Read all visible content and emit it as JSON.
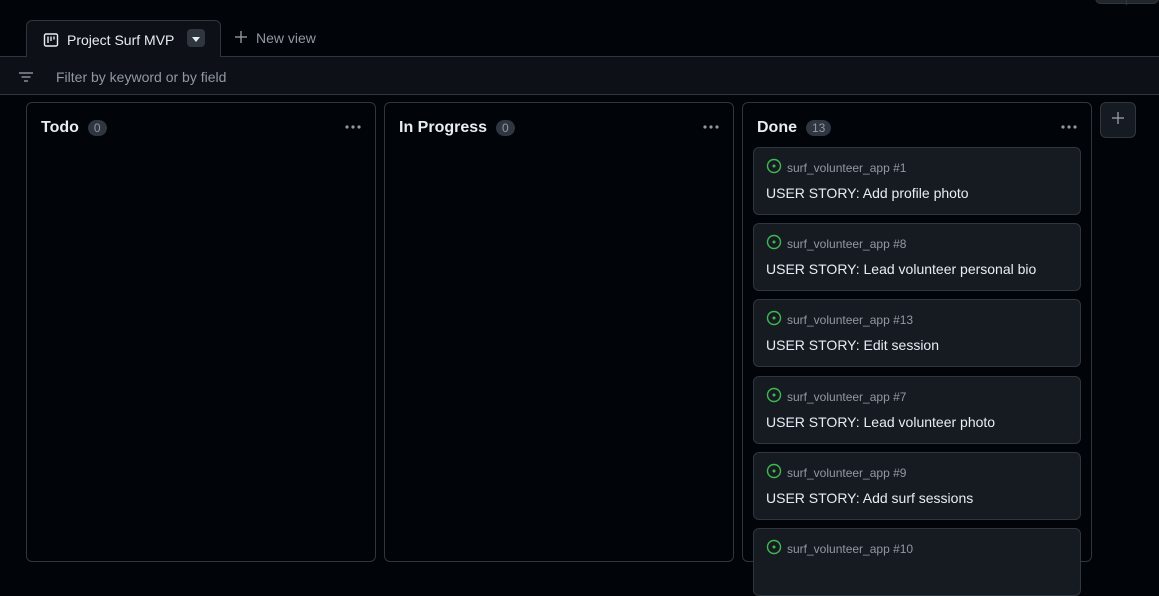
{
  "view_tab": {
    "label": "Project Surf MVP"
  },
  "new_view": {
    "label": "New view"
  },
  "filter": {
    "placeholder": "Filter by keyword or by field"
  },
  "colors": {
    "background": "#010409",
    "card": "#161b22",
    "border": "#30363d",
    "open_issue_green": "#3fb950",
    "muted_text": "#9198a1"
  },
  "icons": {
    "view": "table-board-icon",
    "caret": "triangle-down-icon",
    "add": "plus-icon",
    "filter": "filter-icon",
    "menu": "kebab-horizontal-icon",
    "issue": "issue-opened-icon"
  },
  "columns": [
    {
      "title": "Todo",
      "count": "0",
      "cards": []
    },
    {
      "title": "In Progress",
      "count": "0",
      "cards": []
    },
    {
      "title": "Done",
      "count": "13",
      "cards": [
        {
          "repo": "surf_volunteer_app #1",
          "title": "USER STORY: Add profile photo"
        },
        {
          "repo": "surf_volunteer_app #8",
          "title": "USER STORY: Lead volunteer personal bio"
        },
        {
          "repo": "surf_volunteer_app #13",
          "title": "USER STORY: Edit session"
        },
        {
          "repo": "surf_volunteer_app #7",
          "title": "USER STORY: Lead volunteer photo"
        },
        {
          "repo": "surf_volunteer_app #9",
          "title": "USER STORY: Add surf sessions"
        },
        {
          "repo": "surf_volunteer_app #10",
          "title": ""
        }
      ]
    }
  ]
}
